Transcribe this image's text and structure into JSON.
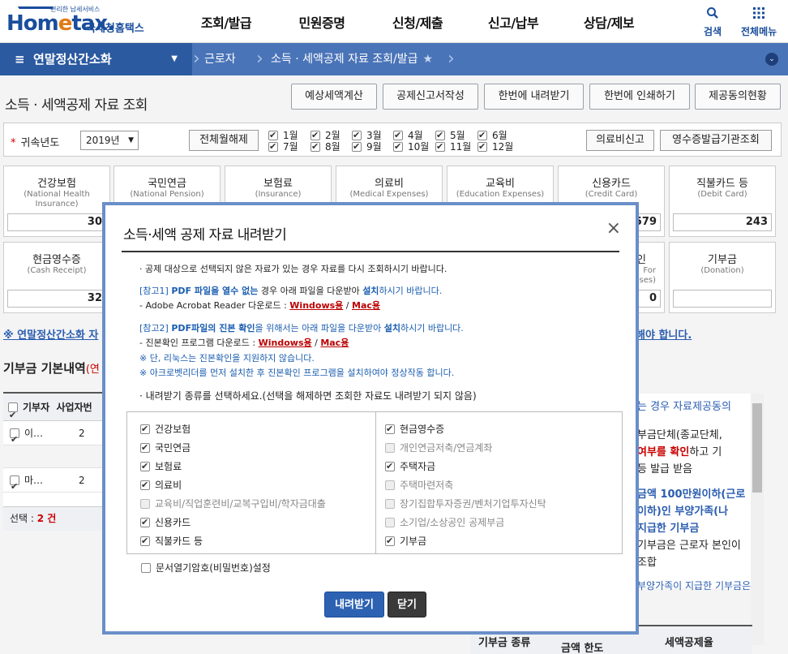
{
  "header": {
    "logo_small": "편리한 납세서비스",
    "logo_brand_a": "Hom",
    "logo_brand_b": "e",
    "logo_brand_c": "tax.",
    "logo_name": "국세청홈택스",
    "gnb": [
      "조회/발급",
      "민원증명",
      "신청/제출",
      "신고/납부",
      "상담/제보"
    ],
    "search_label": "검색",
    "all_menu_label": "전체메뉴"
  },
  "nav": {
    "menu": "연말정산간소화",
    "crumb1": "근로자",
    "crumb2": "소득 · 세액공제 자료 조회/발급"
  },
  "page": {
    "title": "소득 · 세액공제 자료 조회",
    "buttons": [
      "예상세액계산",
      "공제신고서작성",
      "한번에 내려받기",
      "한번에 인쇄하기",
      "제공동의현황"
    ],
    "year_label": "귀속년도",
    "year_value": "2019년",
    "toggle_all": "전체월해제",
    "months": [
      "1월",
      "2월",
      "3월",
      "4월",
      "5월",
      "6월",
      "7월",
      "8월",
      "9월",
      "10월",
      "11월",
      "12월"
    ],
    "btn_medical": "의료비신고",
    "btn_receipt_org": "영수증발급기관조회"
  },
  "cards_row1": [
    {
      "kr": "건강보험",
      "en": "(National Health Insurance)",
      "value": "30"
    },
    {
      "kr": "국민연금",
      "en": "(National Pension)",
      "value": ""
    },
    {
      "kr": "보험료",
      "en": "(Insurance)",
      "value": ""
    },
    {
      "kr": "의료비",
      "en": "(Medical Expenses)",
      "value": ""
    },
    {
      "kr": "교육비",
      "en": "(Education Expenses)",
      "value": ""
    },
    {
      "kr": "신용카드",
      "en": "(Credit Card)",
      "value": "579"
    },
    {
      "kr": "직불카드 등",
      "en": "(Debit Card)",
      "value": "243"
    }
  ],
  "cards_row2": [
    {
      "kr": "현금영수증",
      "en": "(Cash Receipt)",
      "value": "32"
    },
    {
      "kr": "인",
      "en": "For\nses)",
      "value": "0"
    },
    {
      "kr": "기부금",
      "en": "(Donation)",
      "value": ""
    }
  ],
  "notices": {
    "left": "※ 연말정산간소화 자",
    "right": "해야 합니다."
  },
  "donation": {
    "title": "기부금 기본내역",
    "title_suffix": "(연",
    "headers": [
      "기부자",
      "사업자번"
    ],
    "rows": [
      {
        "name": "이…",
        "code": "2"
      },
      {
        "name": "마…",
        "code": "2"
      }
    ],
    "selected_label": "선택 :",
    "selected_count": "2 건"
  },
  "right_panel": {
    "l1": "는 경우 자료제공동의",
    "l2": "부금단체(종교단체,",
    "l3a": "여부를 확인",
    "l3b": "하고 기",
    "l4": "등 발급 받음",
    "l5": "금액 100만원이하(근로",
    "l6": "이하)인 부양가족(나",
    "l7": "지급한 기부금",
    "l8": "기부금은 근로자 본인이",
    "l9": "조합",
    "l10": "부양가족이 지급한 기부금은",
    "t_head1": "기부금 종류",
    "t_head2": "금액 한도",
    "t_head3": "세액공제율"
  },
  "modal": {
    "title": "소득·세액 공제 자료 내려받기",
    "close": "×",
    "notice": "· 공제 대상으로 선택되지 않은 자료가 있는 경우 자료를 다시 조회하시기 바랍니다.",
    "ref1_a": "[참고1] ",
    "ref1_b": "PDF 파일을 열수 없는",
    "ref1_c": " 경우  아래 파일을 다운받아 ",
    "ref1_d": "설치",
    "ref1_e": "하시기 바랍니다.",
    "ref1_line": "- Adobe Acrobat Reader 다운로드 : ",
    "ref2_a": "[참고2] ",
    "ref2_b": "PDF파일의 진본 확인",
    "ref2_c": "을 위해서는 아래 파일을 다운받아 ",
    "ref2_d": "설치",
    "ref2_e": "하시기 바랍니다.",
    "ref2_line": "- 진본확인 프로그램 다운로드 : ",
    "win": "Windows용",
    "slash": " / ",
    "mac": "Mac용",
    "linux": "※ 단, 리눅스는 진본확인을 지원하지 않습니다.",
    "acrobat": "※ 아크로벳리더를 먼저 설치한 후 진본확인 프로그램을 설치하여야 정상작동 합니다.",
    "choose": "· 내려받기 종류를 선택하세요.(선택을 해제하면 조회한 자료도 내려받기 되지 않음)",
    "left_opts": [
      {
        "label": "건강보험",
        "checked": true,
        "disabled": false
      },
      {
        "label": "국민연금",
        "checked": true,
        "disabled": false
      },
      {
        "label": "보험료",
        "checked": true,
        "disabled": false
      },
      {
        "label": "의료비",
        "checked": true,
        "disabled": false
      },
      {
        "label": "교육비/직업훈련비/교복구입비/학자금대출",
        "checked": false,
        "disabled": true
      },
      {
        "label": "신용카드",
        "checked": true,
        "disabled": false
      },
      {
        "label": "직불카드 등",
        "checked": true,
        "disabled": false
      }
    ],
    "right_opts": [
      {
        "label": "현금영수증",
        "checked": true,
        "disabled": false
      },
      {
        "label": "개인연금저축/연금계좌",
        "checked": false,
        "disabled": true
      },
      {
        "label": "주택자금",
        "checked": true,
        "disabled": false
      },
      {
        "label": "주택마련저축",
        "checked": false,
        "disabled": true
      },
      {
        "label": "장기집합투자증권/벤처기업투자신탁",
        "checked": false,
        "disabled": true
      },
      {
        "label": "소기업/소상공인 공제부금",
        "checked": false,
        "disabled": true
      },
      {
        "label": "기부금",
        "checked": true,
        "disabled": false
      }
    ],
    "password_opt": "문서열기암호(비밀번호)설정",
    "btn_download": "내려받기",
    "btn_close": "닫기"
  }
}
